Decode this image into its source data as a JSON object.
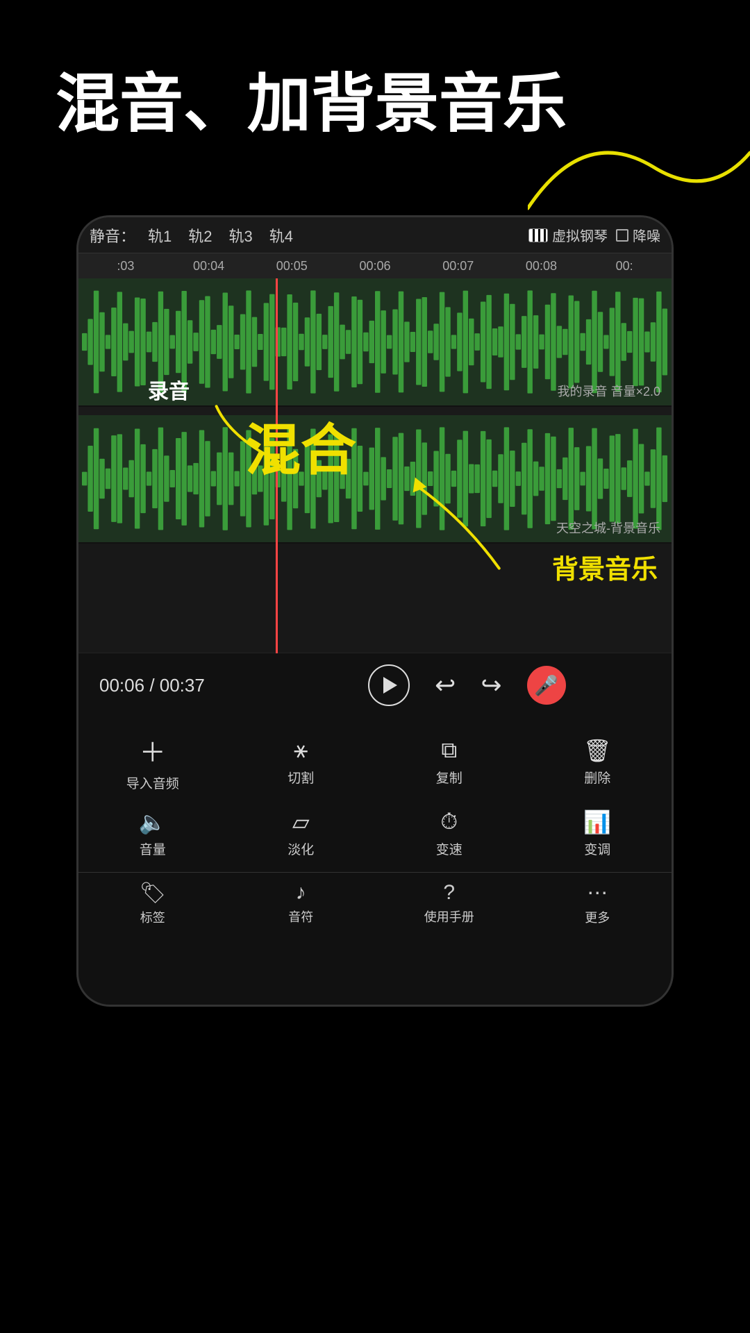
{
  "hero": {
    "title": "混音、加背景音乐"
  },
  "topbar": {
    "mute_label": "静音：",
    "tracks": [
      "轨1",
      "轨2",
      "轨3",
      "轨4"
    ],
    "piano_label": "虚拟钢琴",
    "denoise_label": "降噪"
  },
  "ruler": {
    "ticks": [
      ":03",
      "00:04",
      "00:05",
      "00:06",
      "00:07",
      "00:08",
      "00:"
    ]
  },
  "tracks": [
    {
      "label": "我的录音 音量×2.0",
      "type": "recording"
    },
    {
      "label": "天空之城-背景音乐",
      "type": "bgm"
    }
  ],
  "annotations": {
    "recording_label": "录音",
    "mix_label": "混合",
    "bgmusic_label": "背景音乐"
  },
  "transport": {
    "current_time": "00:06",
    "total_time": "00:37",
    "separator": "/"
  },
  "tools_row1": [
    {
      "icon": "+",
      "label": "导入音频"
    },
    {
      "icon": "切",
      "label": "切割"
    },
    {
      "icon": "复",
      "label": "复制"
    },
    {
      "icon": "删",
      "label": "删除"
    }
  ],
  "tools_row2": [
    {
      "icon": "量",
      "label": "音量"
    },
    {
      "icon": "淡",
      "label": "淡化"
    },
    {
      "icon": "速",
      "label": "变速"
    },
    {
      "icon": "调",
      "label": "变调"
    }
  ],
  "bottom_nav": [
    {
      "icon": "🏷",
      "label": "标签"
    },
    {
      "icon": "♪",
      "label": "音符"
    },
    {
      "icon": "?",
      "label": "使用手册"
    },
    {
      "icon": "⋯",
      "label": "更多"
    }
  ]
}
